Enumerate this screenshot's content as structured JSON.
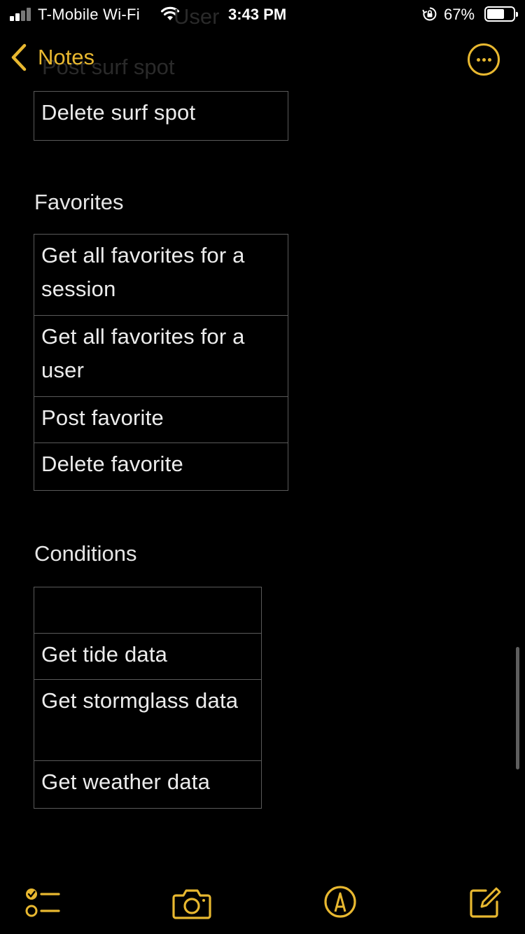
{
  "status_bar": {
    "carrier": "T-Mobile Wi-Fi",
    "time": "3:43 PM",
    "battery_percent": "67%",
    "battery_level": 0.67
  },
  "ghost": {
    "line1": "User",
    "line2": "Post surf spot"
  },
  "nav": {
    "back_label": "Notes",
    "accent_color": "#e8b830"
  },
  "sections": {
    "surf_spots": {
      "rows": [
        "Delete surf spot"
      ]
    },
    "favorites": {
      "heading": "Favorites",
      "rows": [
        "Get all favorites for a session",
        "Get all favorites for a user",
        "Post favorite",
        "Delete favorite"
      ]
    },
    "conditions": {
      "heading": "Conditions",
      "rows": [
        "",
        "Get tide data",
        "Get stormglass data",
        "Get weather data"
      ]
    }
  },
  "toolbar": {
    "icons": [
      "checklist-icon",
      "camera-icon",
      "markup-icon",
      "compose-icon"
    ]
  }
}
